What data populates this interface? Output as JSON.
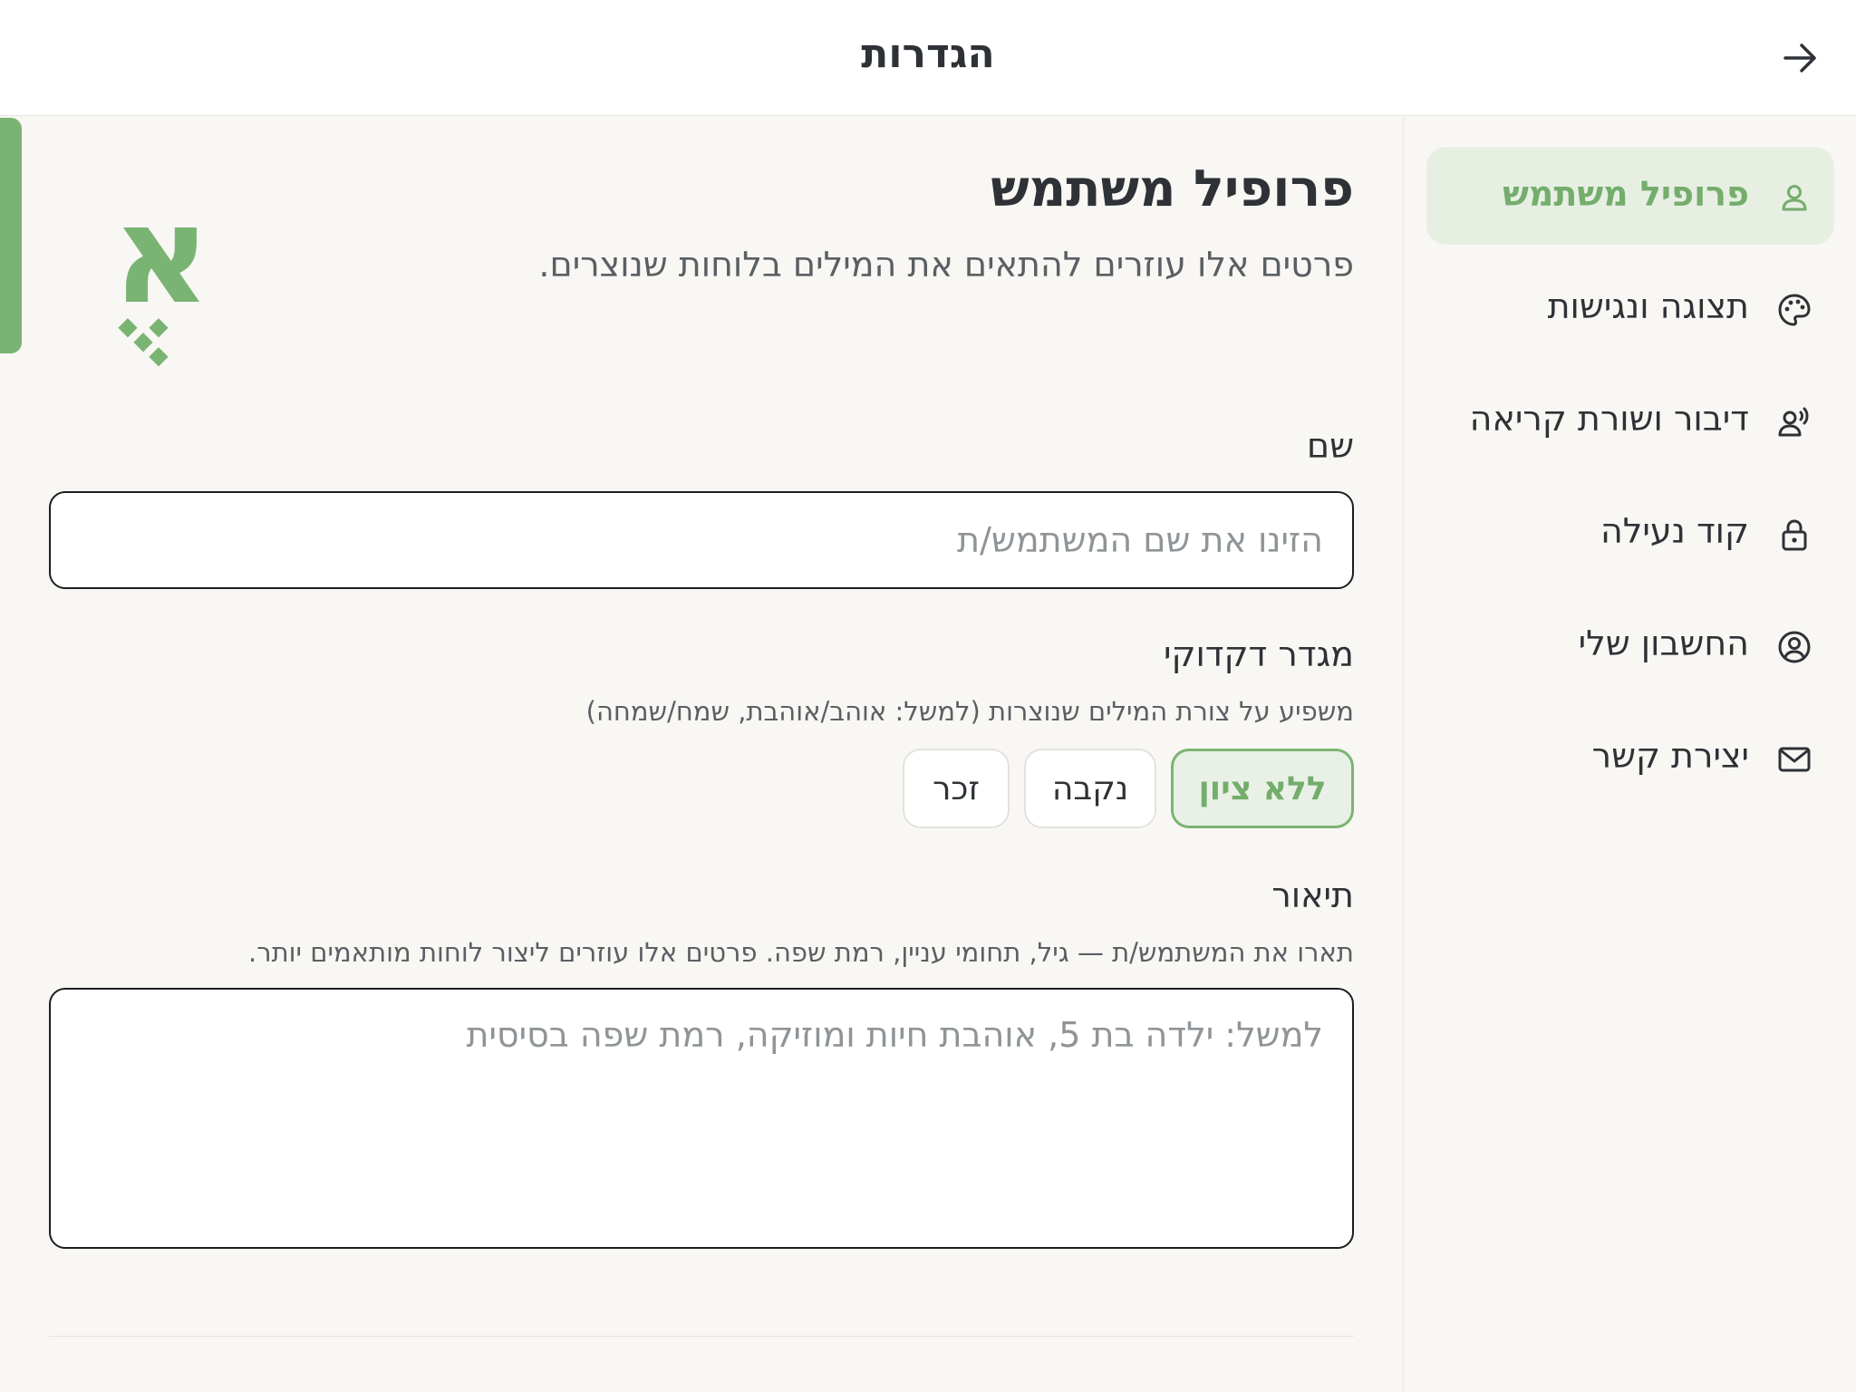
{
  "header": {
    "title": "הגדרות",
    "back_icon": "arrow-right-icon"
  },
  "sidebar": {
    "items": [
      {
        "label": "פרופיל משתמש",
        "icon": "user-icon",
        "active": true
      },
      {
        "label": "תצוגה ונגישות",
        "icon": "palette-icon",
        "active": false
      },
      {
        "label": "דיבור ושורת קריאה",
        "icon": "speaking-person-icon",
        "active": false
      },
      {
        "label": "קוד נעילה",
        "icon": "lock-icon",
        "active": false
      },
      {
        "label": "החשבון שלי",
        "icon": "user-circle-icon",
        "active": false
      },
      {
        "label": "יצירת קשר",
        "icon": "mail-icon",
        "active": false
      }
    ]
  },
  "main": {
    "logo_letter": "א",
    "title": "פרופיל משתמש",
    "subtitle": "פרטים אלו עוזרים להתאים את המילים בלוחות שנוצרים.",
    "name_field": {
      "label": "שם",
      "value": "",
      "placeholder": "הזינו את שם המשתמש/ת"
    },
    "gender": {
      "label": "מגדר דקדוקי",
      "help": "משפיע על צורת המילים שנוצרות (למשל: אוהב/אוהבת, שמח/שמחה)",
      "options": [
        "ללא ציון",
        "נקבה",
        "זכר"
      ],
      "selected": "ללא ציון"
    },
    "description": {
      "label": "תיאור",
      "help": "תארו את המשתמש/ת — גיל, תחומי עניין, רמת שפה. פרטים אלו עוזרים ליצור לוחות מותאמים יותר.",
      "value": "",
      "placeholder": "למשל: ילדה בת 5, אוהבת חיות ומוזיקה, רמת שפה בסיסית"
    }
  },
  "colors": {
    "accent": "#7ab472",
    "accent_bg": "#e7efe3",
    "background": "#f8f7f4",
    "text": "#2e3236"
  }
}
